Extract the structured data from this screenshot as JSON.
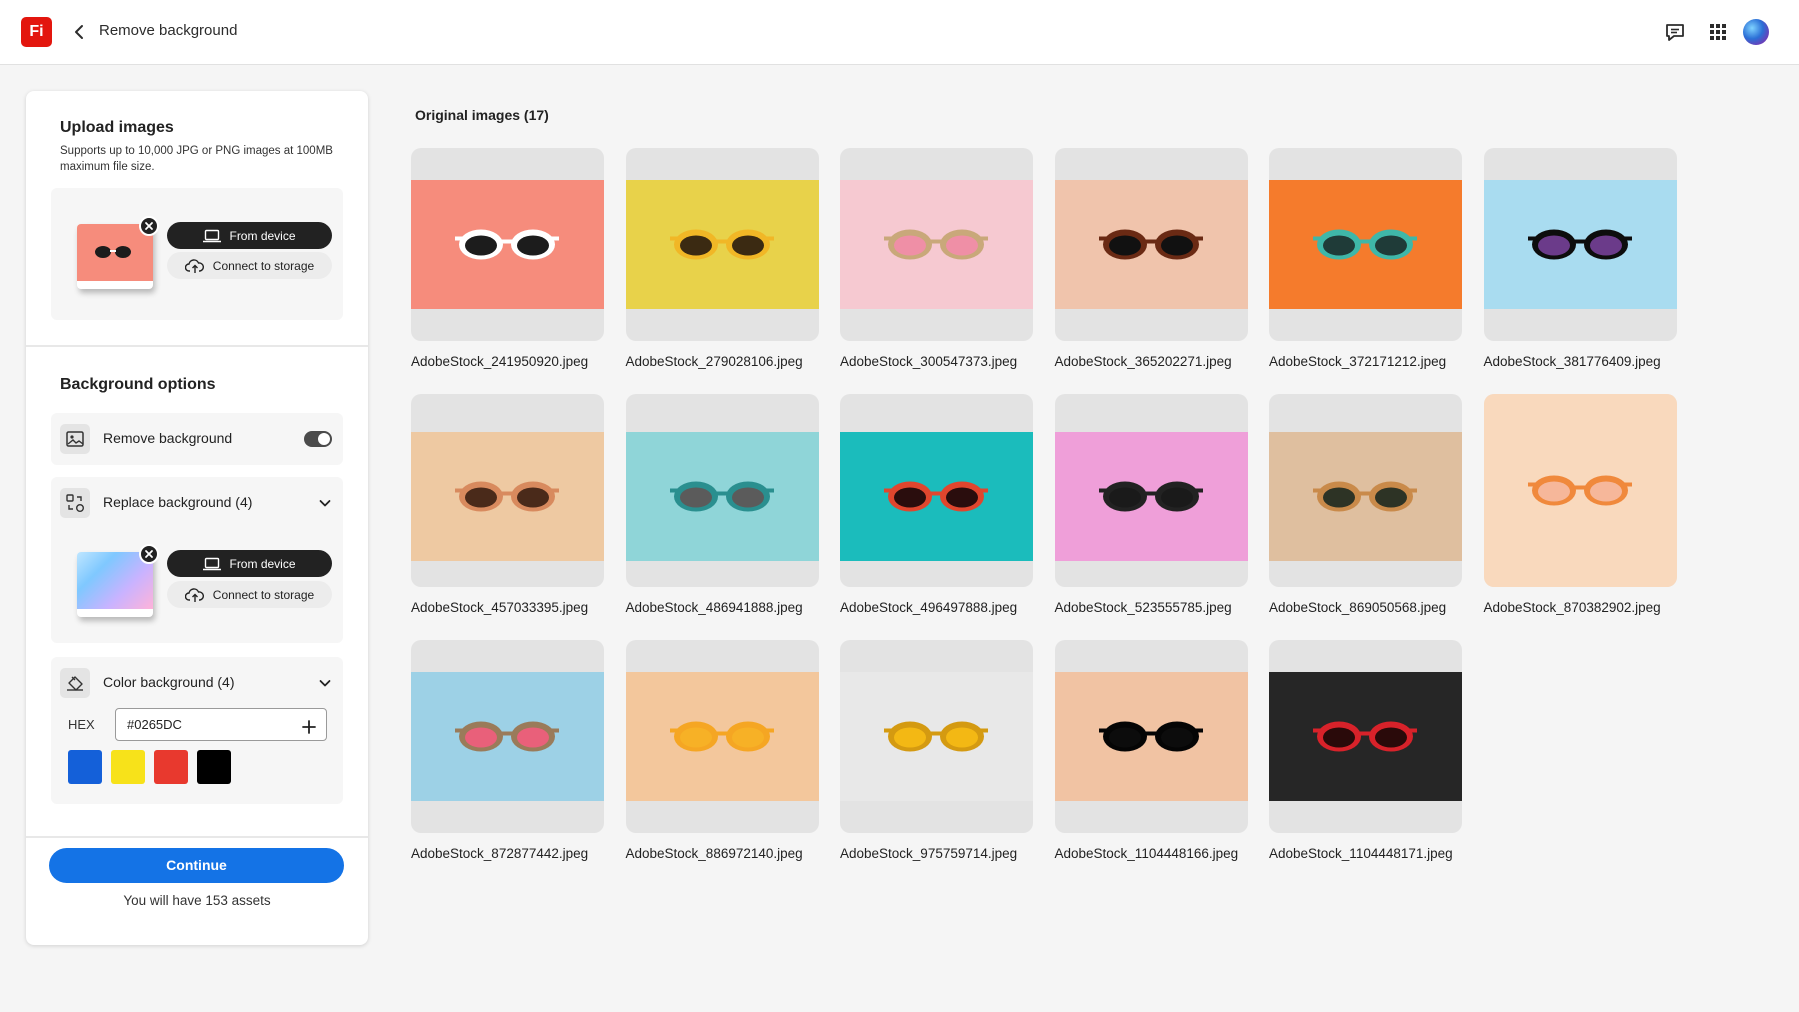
{
  "header": {
    "app_logo": "Fi",
    "title": "Remove background",
    "icons": [
      "back-chevron-icon",
      "comment-icon",
      "apps-grid-icon",
      "avatar"
    ]
  },
  "upload": {
    "title": "Upload images",
    "description": "Supports up to 10,000 JPG or PNG images at 100MB maximum file size.",
    "from_device": "From device",
    "connect_storage": "Connect to storage"
  },
  "background_options": {
    "title": "Background options",
    "remove_label": "Remove background",
    "remove_enabled": true,
    "replace_label": "Replace background (4)",
    "replace_from_device": "From device",
    "replace_connect_storage": "Connect to storage",
    "color_label": "Color background (4)",
    "hex_label": "HEX",
    "hex_value": "#0265DC",
    "swatches": [
      "#1460d9",
      "#f7e21a",
      "#e8392e",
      "#000000"
    ]
  },
  "footer": {
    "continue": "Continue",
    "assets_note": "You will have 153 assets"
  },
  "gallery": {
    "title": "Original images (17)",
    "images": [
      {
        "name": "AdobeStock_241950920.jpeg",
        "bg": "#f68c7c",
        "frame": "#f68c7c",
        "lens": "#1c1c1c",
        "rim": "#ffffff"
      },
      {
        "name": "AdobeStock_279028106.jpeg",
        "bg": "#e8d24a",
        "frame": "#e8d24a",
        "lens": "#3b2a12",
        "rim": "#f1b726"
      },
      {
        "name": "AdobeStock_300547373.jpeg",
        "bg": "#f6c9d1",
        "frame": "#f6c9d1",
        "lens": "#ef8fa6",
        "rim": "#c9a87a"
      },
      {
        "name": "AdobeStock_365202271.jpeg",
        "bg": "#f0c4ac",
        "frame": "#f0c4ac",
        "lens": "#111111",
        "rim": "#6a2a14"
      },
      {
        "name": "AdobeStock_372171212.jpeg",
        "bg": "#f57b2c",
        "frame": "#f57b2c",
        "lens": "#1f3b38",
        "rim": "#3fb7a8"
      },
      {
        "name": "AdobeStock_381776409.jpeg",
        "bg": "#a9dcf0",
        "frame": "#a9dcf0",
        "lens": "#6b3b8a",
        "rim": "#0d0d0d"
      },
      {
        "name": "AdobeStock_457033395.jpeg",
        "bg": "#eec9a2",
        "frame": "#eec9a2",
        "lens": "#4a2a1a",
        "rim": "#d88a5e"
      },
      {
        "name": "AdobeStock_486941888.jpeg",
        "bg": "#8fd5d8",
        "frame": "#8fd5d8",
        "lens": "#5b5b5b",
        "rim": "#2a8f8f"
      },
      {
        "name": "AdobeStock_496497888.jpeg",
        "bg": "#1bbcbc",
        "frame": "#1bbcbc",
        "lens": "#2a0d0d",
        "rim": "#e0462e"
      },
      {
        "name": "AdobeStock_523555785.jpeg",
        "bg": "#ef9fd9",
        "frame": "#ef9fd9",
        "lens": "#1a1a1a",
        "rim": "#222222"
      },
      {
        "name": "AdobeStock_869050568.jpeg",
        "bg": "#dfbf9f",
        "frame": "#dfbf9f",
        "lens": "#2d3325",
        "rim": "#c98a4a"
      },
      {
        "name": "AdobeStock_870382902.jpeg",
        "bg": "#f9d9bd",
        "frame": "#f9d9bd",
        "lens": "#f6b79a",
        "rim": "#f0893c"
      },
      {
        "name": "AdobeStock_872877442.jpeg",
        "bg": "#9dd1e6",
        "frame": "#9dd1e6",
        "lens": "#e9607a",
        "rim": "#9a7b5a"
      },
      {
        "name": "AdobeStock_886972140.jpeg",
        "bg": "#f3c79c",
        "frame": "#f3c79c",
        "lens": "#f7b126",
        "rim": "#f5a623"
      },
      {
        "name": "AdobeStock_975759714.jpeg",
        "bg": "#e8e8e8",
        "frame": "#e8e8e8",
        "lens": "#f3b814",
        "rim": "#d49a11"
      },
      {
        "name": "AdobeStock_1104448166.jpeg",
        "bg": "#f1c3a3",
        "frame": "#f1c3a3",
        "lens": "#0c0c0c",
        "rim": "#050505"
      },
      {
        "name": "AdobeStock_1104448171.jpeg",
        "bg": "#262626",
        "frame": "#262626",
        "lens": "#2a0a0a",
        "rim": "#d8222a"
      }
    ]
  }
}
